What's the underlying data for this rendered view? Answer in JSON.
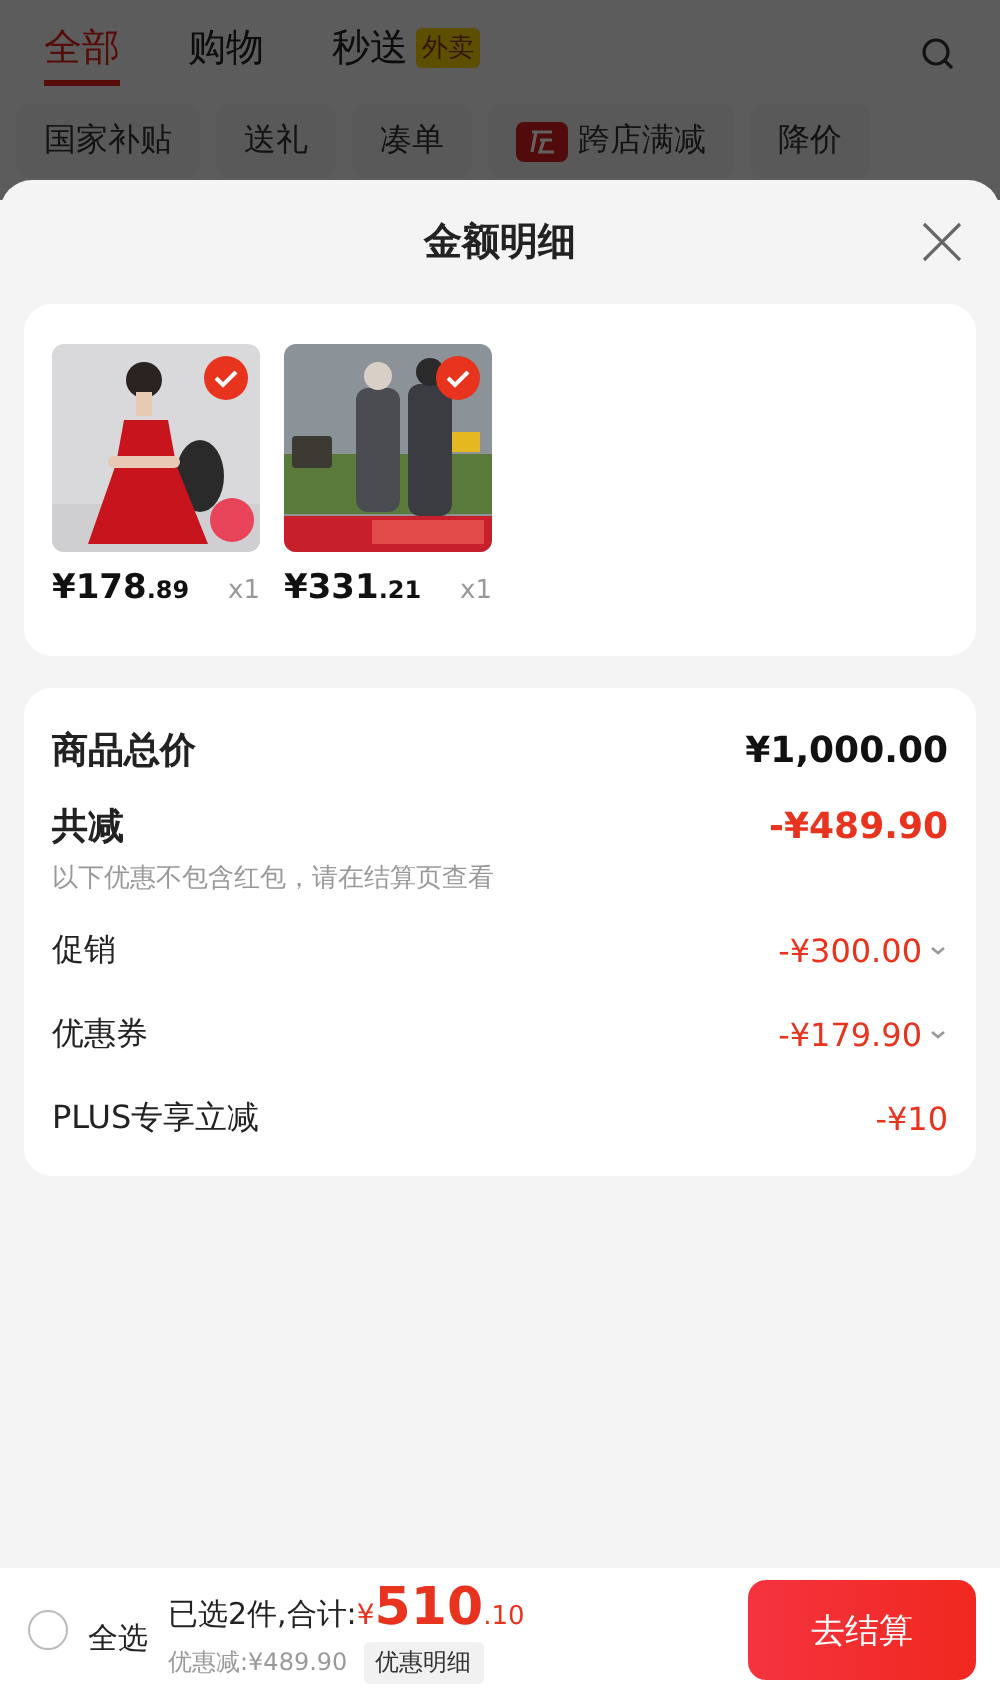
{
  "tabs": [
    {
      "label": "全部",
      "selected": true
    },
    {
      "label": "购物",
      "selected": false
    },
    {
      "label": "秒送",
      "selected": false,
      "badge": "外卖"
    }
  ],
  "chips": [
    {
      "label": "国家补贴"
    },
    {
      "label": "送礼"
    },
    {
      "label": "凑单"
    },
    {
      "label": "跨店满减",
      "icon": true
    },
    {
      "label": "降价"
    }
  ],
  "sheet": {
    "title": "金额明细",
    "products": [
      {
        "kind": "dress",
        "selected": true,
        "price_main": "¥178",
        "price_cents": ".89",
        "quantity": "x1"
      },
      {
        "kind": "coats",
        "selected": true,
        "price_main": "¥331",
        "price_cents": ".21",
        "quantity": "x1"
      }
    ],
    "breakdown": [
      {
        "kind": "total",
        "label": "商品总价",
        "amount": "¥1,000.00"
      },
      {
        "kind": "reduction",
        "label": "共减",
        "amount": "-¥489.90",
        "note": "以下优惠不包含红包，请在结算页查看"
      },
      {
        "kind": "item",
        "label": "促销",
        "amount": "-¥300.00",
        "expandable": true
      },
      {
        "kind": "item",
        "label": "优惠券",
        "amount": "-¥179.90",
        "expandable": true
      },
      {
        "kind": "item",
        "label": "PLUS专享立减",
        "amount": "-¥10",
        "expandable": false
      }
    ]
  },
  "bottom_bar": {
    "select_all": {
      "label": "全选",
      "checked": false
    },
    "summary": "已选2件,合计:",
    "currency": "¥",
    "total_main": "510",
    "total_cents": ".10",
    "discount": "优惠减:¥489.90",
    "detail_button": "优惠明细",
    "checkout_button": "去结算"
  }
}
